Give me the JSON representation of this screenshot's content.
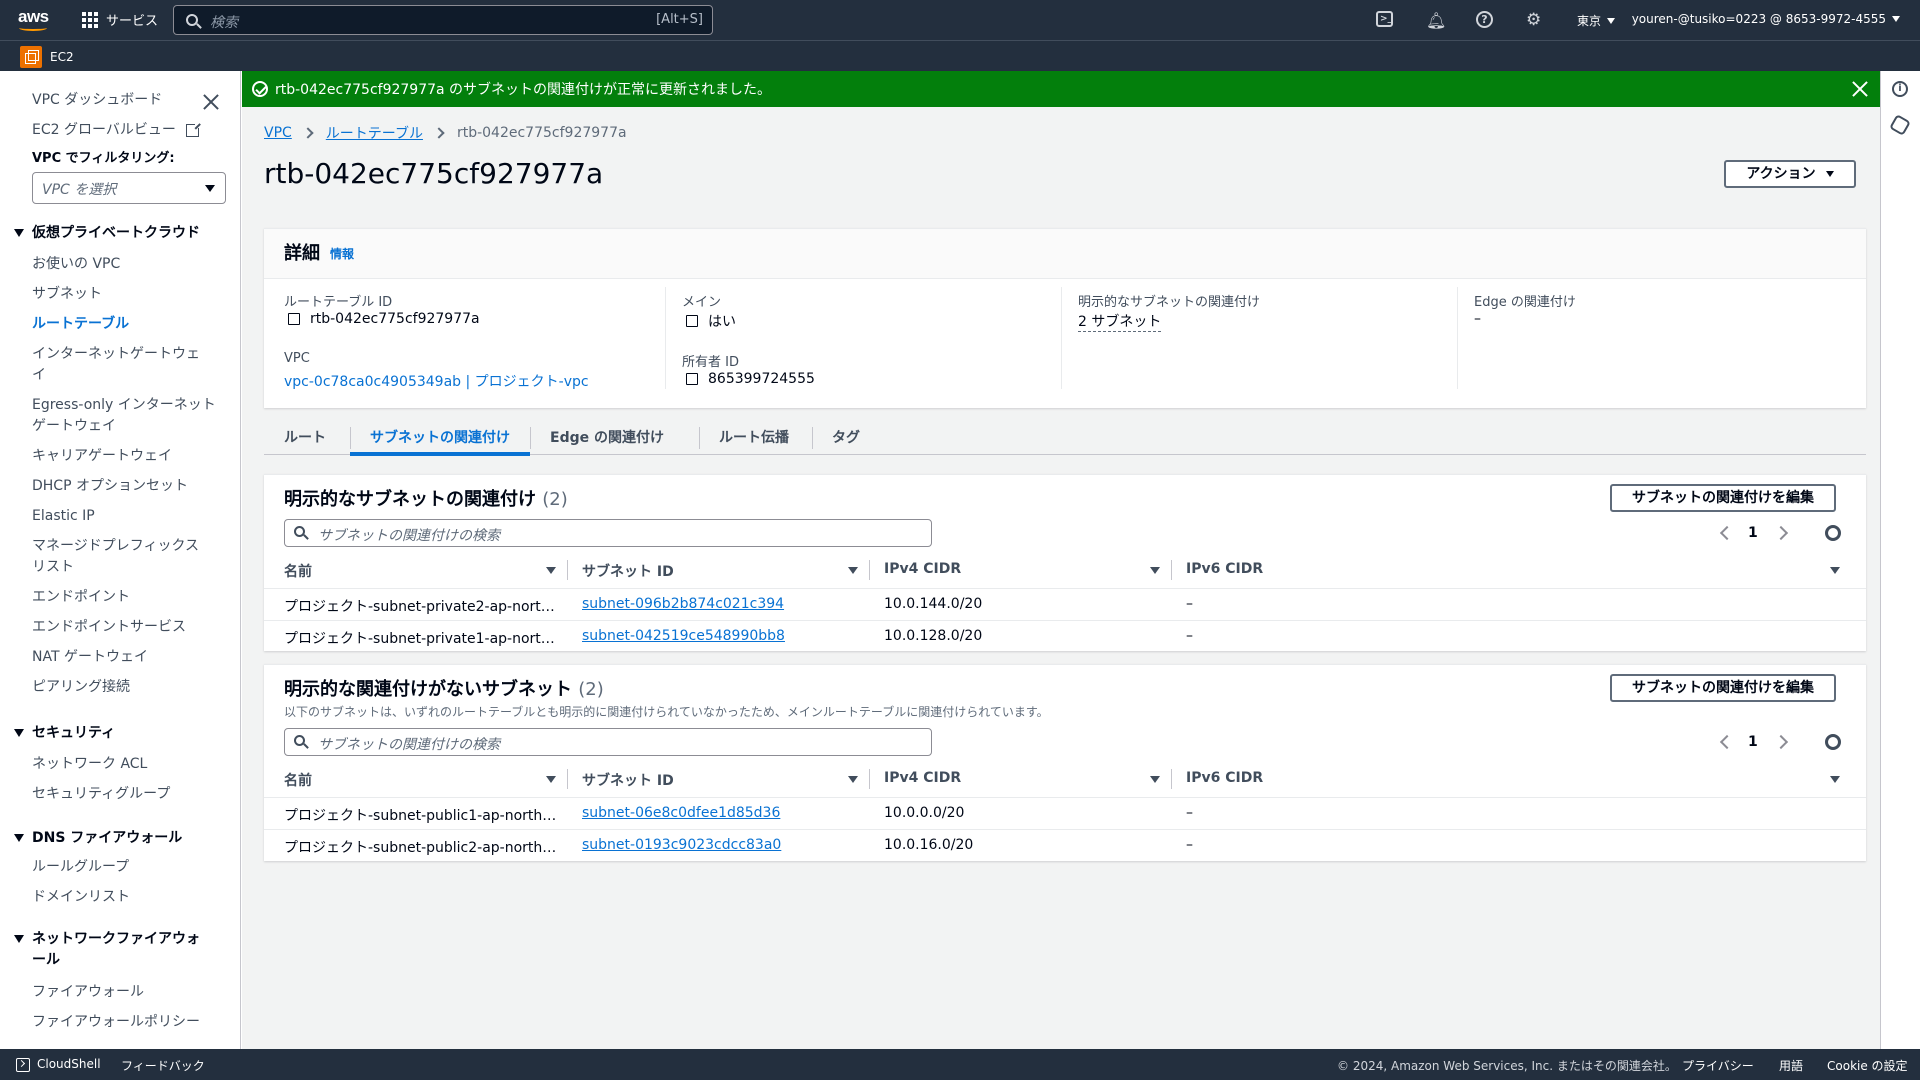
{
  "header": {
    "services_label": "サービス",
    "search_placeholder": "検索",
    "search_shortcut": "[Alt+S]",
    "region": "東京",
    "account": "youren-@tusiko=0223 @ 8653-9972-4555",
    "service_name": "EC2"
  },
  "flash": {
    "message": "rtb-042ec775cf927977a のサブネットの関連付けが正常に更新されました。"
  },
  "sidebar": {
    "top_items": [
      "VPC ダッシュボード",
      "EC2 グローバルビュー"
    ],
    "filter_label": "VPC でフィルタリング:",
    "filter_placeholder": "VPC を選択",
    "sections": [
      {
        "title": "仮想プライベートクラウド",
        "items": [
          "お使いの VPC",
          "サブネット",
          "ルートテーブル",
          "インターネットゲートウェイ",
          "Egress-only インターネットゲートウェイ",
          "キャリアゲートウェイ",
          "DHCP オプションセット",
          "Elastic IP",
          "マネージドプレフィックスリスト",
          "エンドポイント",
          "エンドポイントサービス",
          "NAT ゲートウェイ",
          "ピアリング接続"
        ]
      },
      {
        "title": "セキュリティ",
        "items": [
          "ネットワーク ACL",
          "セキュリティグループ"
        ]
      },
      {
        "title": "DNS ファイアウォール",
        "items": [
          "ルールグループ",
          "ドメインリスト"
        ]
      },
      {
        "title": "ネットワークファイアウォール",
        "items": [
          "ファイアウォール",
          "ファイアウォールポリシー"
        ]
      }
    ],
    "active_item": "ルートテーブル"
  },
  "breadcrumb": [
    "VPC",
    "ルートテーブル",
    "rtb-042ec775cf927977a"
  ],
  "page": {
    "title": "rtb-042ec775cf927977a",
    "actions_label": "アクション"
  },
  "details": {
    "title": "詳細",
    "info": "情報",
    "route_table_id_label": "ルートテーブル ID",
    "route_table_id": "rtb-042ec775cf927977a",
    "vpc_label": "VPC",
    "vpc_value": "vpc-0c78ca0c4905349ab | プロジェクト-vpc",
    "main_label": "メイン",
    "main_value": "はい",
    "owner_label": "所有者 ID",
    "owner_value": "865399724555",
    "explicit_label": "明示的なサブネットの関連付け",
    "explicit_value": "2 サブネット",
    "edge_label": "Edge の関連付け",
    "edge_value": "–"
  },
  "tabs": [
    "ルート",
    "サブネットの関連付け",
    "Edge の関連付け",
    "ルート伝播",
    "タグ"
  ],
  "explicit": {
    "title": "明示的なサブネットの関連付け",
    "count": "(2)",
    "edit_label": "サブネットの関連付けを編集",
    "search_placeholder": "サブネットの関連付けの検索",
    "page": "1",
    "columns": [
      "名前",
      "サブネット ID",
      "IPv4 CIDR",
      "IPv6 CIDR"
    ],
    "rows": [
      {
        "name": "プロジェクト-subnet-private2-ap-nort…",
        "id": "subnet-096b2b874c021c394",
        "ipv4": "10.0.144.0/20",
        "ipv6": "–"
      },
      {
        "name": "プロジェクト-subnet-private1-ap-nort…",
        "id": "subnet-042519ce548990bb8",
        "ipv4": "10.0.128.0/20",
        "ipv6": "–"
      }
    ]
  },
  "implicit": {
    "title": "明示的な関連付けがないサブネット",
    "count": "(2)",
    "description": "以下のサブネットは、いずれのルートテーブルとも明示的に関連付けられていなかったため、メインルートテーブルに関連付けられています。",
    "edit_label": "サブネットの関連付けを編集",
    "search_placeholder": "サブネットの関連付けの検索",
    "page": "1",
    "columns": [
      "名前",
      "サブネット ID",
      "IPv4 CIDR",
      "IPv6 CIDR"
    ],
    "rows": [
      {
        "name": "プロジェクト-subnet-public1-ap-north…",
        "id": "subnet-06e8c0dfee1d85d36",
        "ipv4": "10.0.0.0/20",
        "ipv6": "–"
      },
      {
        "name": "プロジェクト-subnet-public2-ap-north…",
        "id": "subnet-0193c9023cdcc83a0",
        "ipv4": "10.0.16.0/20",
        "ipv6": "–"
      }
    ]
  },
  "footer": {
    "cloudshell": "CloudShell",
    "feedback": "フィードバック",
    "copyright": "© 2024, Amazon Web Services, Inc. またはその関連会社。",
    "privacy": "プライバシー",
    "terms": "用語",
    "cookie": "Cookie の設定"
  }
}
